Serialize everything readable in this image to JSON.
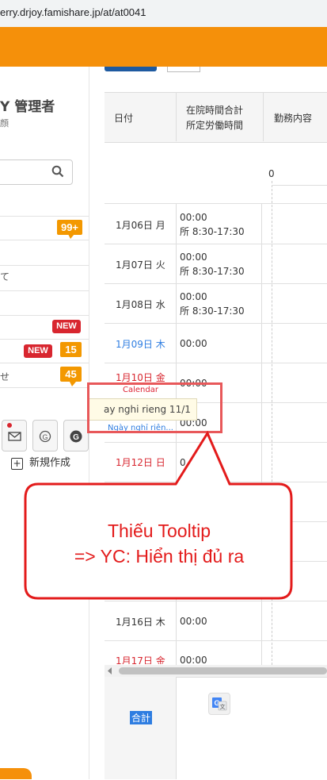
{
  "browser": {
    "url": "erry.drjoy.famishare.jp/at/at0041"
  },
  "sidebar": {
    "title": "Y 管理者",
    "subtitle": "顔",
    "items": [
      {
        "label": "",
        "badge": "99+"
      },
      {
        "label": "て"
      },
      {
        "label": ""
      },
      {
        "label": "",
        "badge_new": "NEW"
      },
      {
        "label": "",
        "badge_new": "NEW",
        "badge": "15"
      },
      {
        "label": "せ",
        "badge": "45"
      }
    ],
    "icons": [
      "mail-icon",
      "google-circle-icon",
      "google-filled-icon"
    ],
    "new_create_label": "新規作成"
  },
  "table": {
    "headers": {
      "date": "日付",
      "hours_line1": "在院時間合計",
      "hours_line2": "所定労働時間",
      "work": "勤務内容"
    },
    "axis_zero": "0",
    "rows": [
      {
        "date": "1月06日 月",
        "time1": "00:00",
        "time2": "所 8:30-17:30",
        "color": "#333333"
      },
      {
        "date": "1月07日 火",
        "time1": "00:00",
        "time2": "所 8:30-17:30",
        "color": "#333333"
      },
      {
        "date": "1月08日 水",
        "time1": "00:00",
        "time2": "所 8:30-17:30",
        "color": "#333333"
      },
      {
        "date": "1月09日 木",
        "time1": "00:00",
        "time2": "",
        "color": "#2e7de1"
      },
      {
        "date": "1月10日 金",
        "time1": "00:00",
        "time2": "",
        "color": "#d8262f"
      },
      {
        "date": "",
        "time1": "00:00",
        "time2": "",
        "color": "#333333"
      },
      {
        "date": "1月12日 日",
        "time1": "0",
        "time2": "",
        "color": "#d8262f"
      },
      {
        "date": "1月16日 木",
        "time1": "00:00",
        "time2": "",
        "color": "#333333"
      },
      {
        "date": "1月17日 金",
        "time1": "00:00",
        "time2": "",
        "color": "#d8262f"
      }
    ],
    "total_label": "合計"
  },
  "tooltip": {
    "calendar_label": "Calendar",
    "text": "ay nghi rieng 11/1",
    "holiday_label": "Ngày nghỉ riên..."
  },
  "annotation": {
    "line1": "Thiếu Tooltip",
    "line2": "=> YC: Hiển thị đủ ra",
    "color": "#e31b1b"
  }
}
